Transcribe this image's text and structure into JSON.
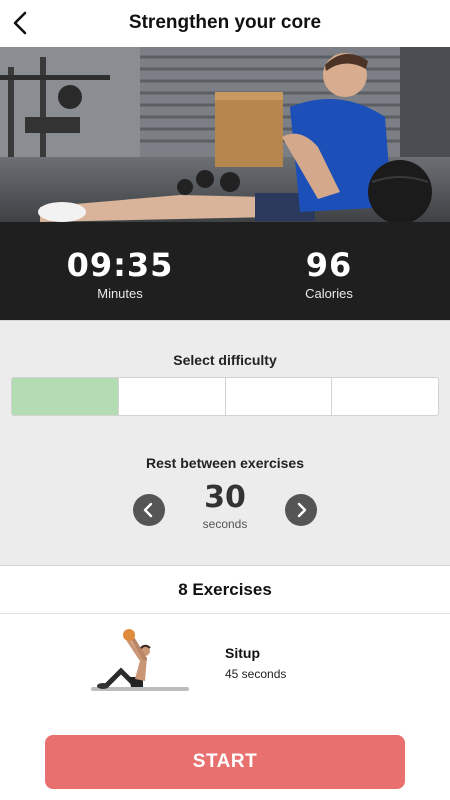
{
  "header": {
    "title": "Strengthen your core",
    "back_icon": "chevron-left-icon"
  },
  "stats": [
    {
      "value": "09:35",
      "label": "Minutes"
    },
    {
      "value": "96",
      "label": "Calories"
    }
  ],
  "difficulty": {
    "label": "Select difficulty",
    "levels": 4,
    "selected_index": 0,
    "selected_color": "#b3dcb3"
  },
  "rest": {
    "label": "Rest between exercises",
    "value": "30",
    "unit": "seconds",
    "decrease_icon": "chevron-left-icon",
    "increase_icon": "chevron-right-icon"
  },
  "exercises": {
    "count_label": "8 Exercises",
    "items": [
      {
        "name": "Situp",
        "duration": "45 seconds"
      }
    ]
  },
  "start_label": "START",
  "colors": {
    "accent": "#e87170",
    "stats_bg": "#1f1f1f",
    "settings_bg": "#ececec"
  }
}
